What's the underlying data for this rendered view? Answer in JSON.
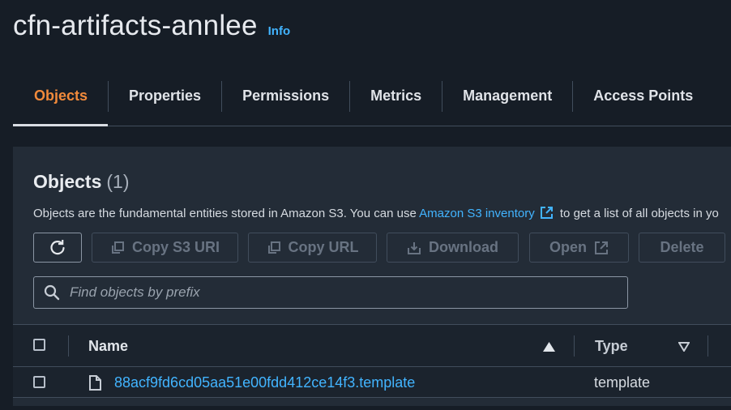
{
  "header": {
    "title": "cfn-artifacts-annlee",
    "info_label": "Info"
  },
  "tabs": [
    {
      "label": "Objects",
      "active": true
    },
    {
      "label": "Properties"
    },
    {
      "label": "Permissions"
    },
    {
      "label": "Metrics"
    },
    {
      "label": "Management"
    },
    {
      "label": "Access Points"
    }
  ],
  "objects_panel": {
    "title": "Objects",
    "count": "(1)",
    "description_before": "Objects are the fundamental entities stored in Amazon S3. You can use ",
    "description_link": "Amazon S3 inventory",
    "description_after": " to get a list of all objects in yo"
  },
  "toolbar": {
    "copy_s3_uri_label": "Copy S3 URI",
    "copy_url_label": "Copy URL",
    "download_label": "Download",
    "open_label": "Open",
    "delete_label": "Delete"
  },
  "search": {
    "placeholder": "Find objects by prefix",
    "value": ""
  },
  "table": {
    "columns": [
      "Name",
      "Type"
    ],
    "rows": [
      {
        "name": "88acf9fd6cd05aa51e00fdd412ce14f3.template",
        "type": "template"
      }
    ]
  },
  "colors": {
    "accent_active_tab": "#f18a3b",
    "link": "#42b4ff",
    "background": "#161d26",
    "panel": "#232c37"
  }
}
